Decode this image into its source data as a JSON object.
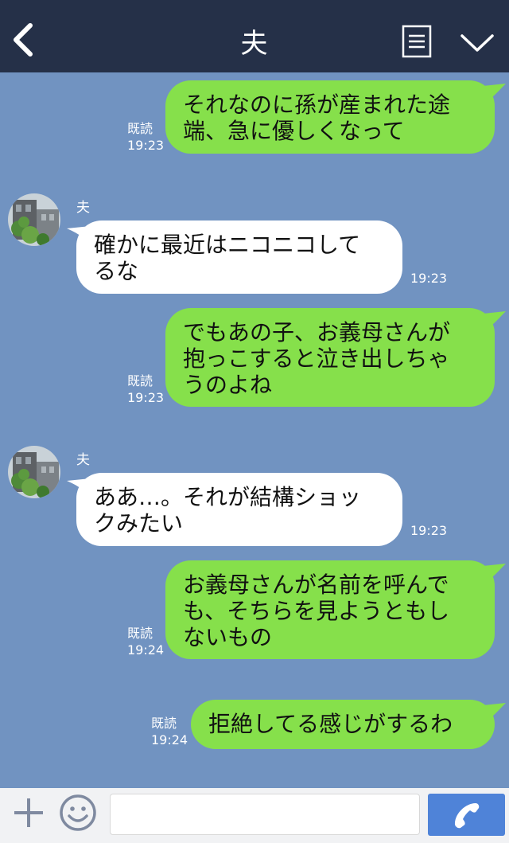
{
  "header": {
    "title": "夫"
  },
  "messages": [
    {
      "type": "out",
      "text": "それなのに孫が産まれた途\n端、急に優しくなって",
      "read": "既読",
      "time": "19:23"
    },
    {
      "type": "in",
      "sender": "夫",
      "text": "確かに最近はニコニコして\nるな",
      "time": "19:23"
    },
    {
      "type": "out",
      "text": "でもあの子、お義母さんが\n抱っこすると泣き出しちゃ\nうのよね",
      "read": "既読",
      "time": "19:23"
    },
    {
      "type": "in",
      "sender": "夫",
      "text": "ああ…。それが結構ショッ\nクみたい",
      "time": "19:23"
    },
    {
      "type": "out",
      "text": "お義母さんが名前を呼んで\nも、そちらを見ようともし\nないもの",
      "read": "既読",
      "time": "19:24"
    },
    {
      "type": "out",
      "text": "拒絶してる感じがするわ",
      "read": "既読",
      "time": "19:24"
    }
  ],
  "input": {
    "value": "",
    "placeholder": ""
  },
  "colors": {
    "header": "#253048",
    "background": "#7193c1",
    "out_bubble": "#86e04b",
    "in_bubble": "#ffffff",
    "call_button": "#4f83d8"
  }
}
